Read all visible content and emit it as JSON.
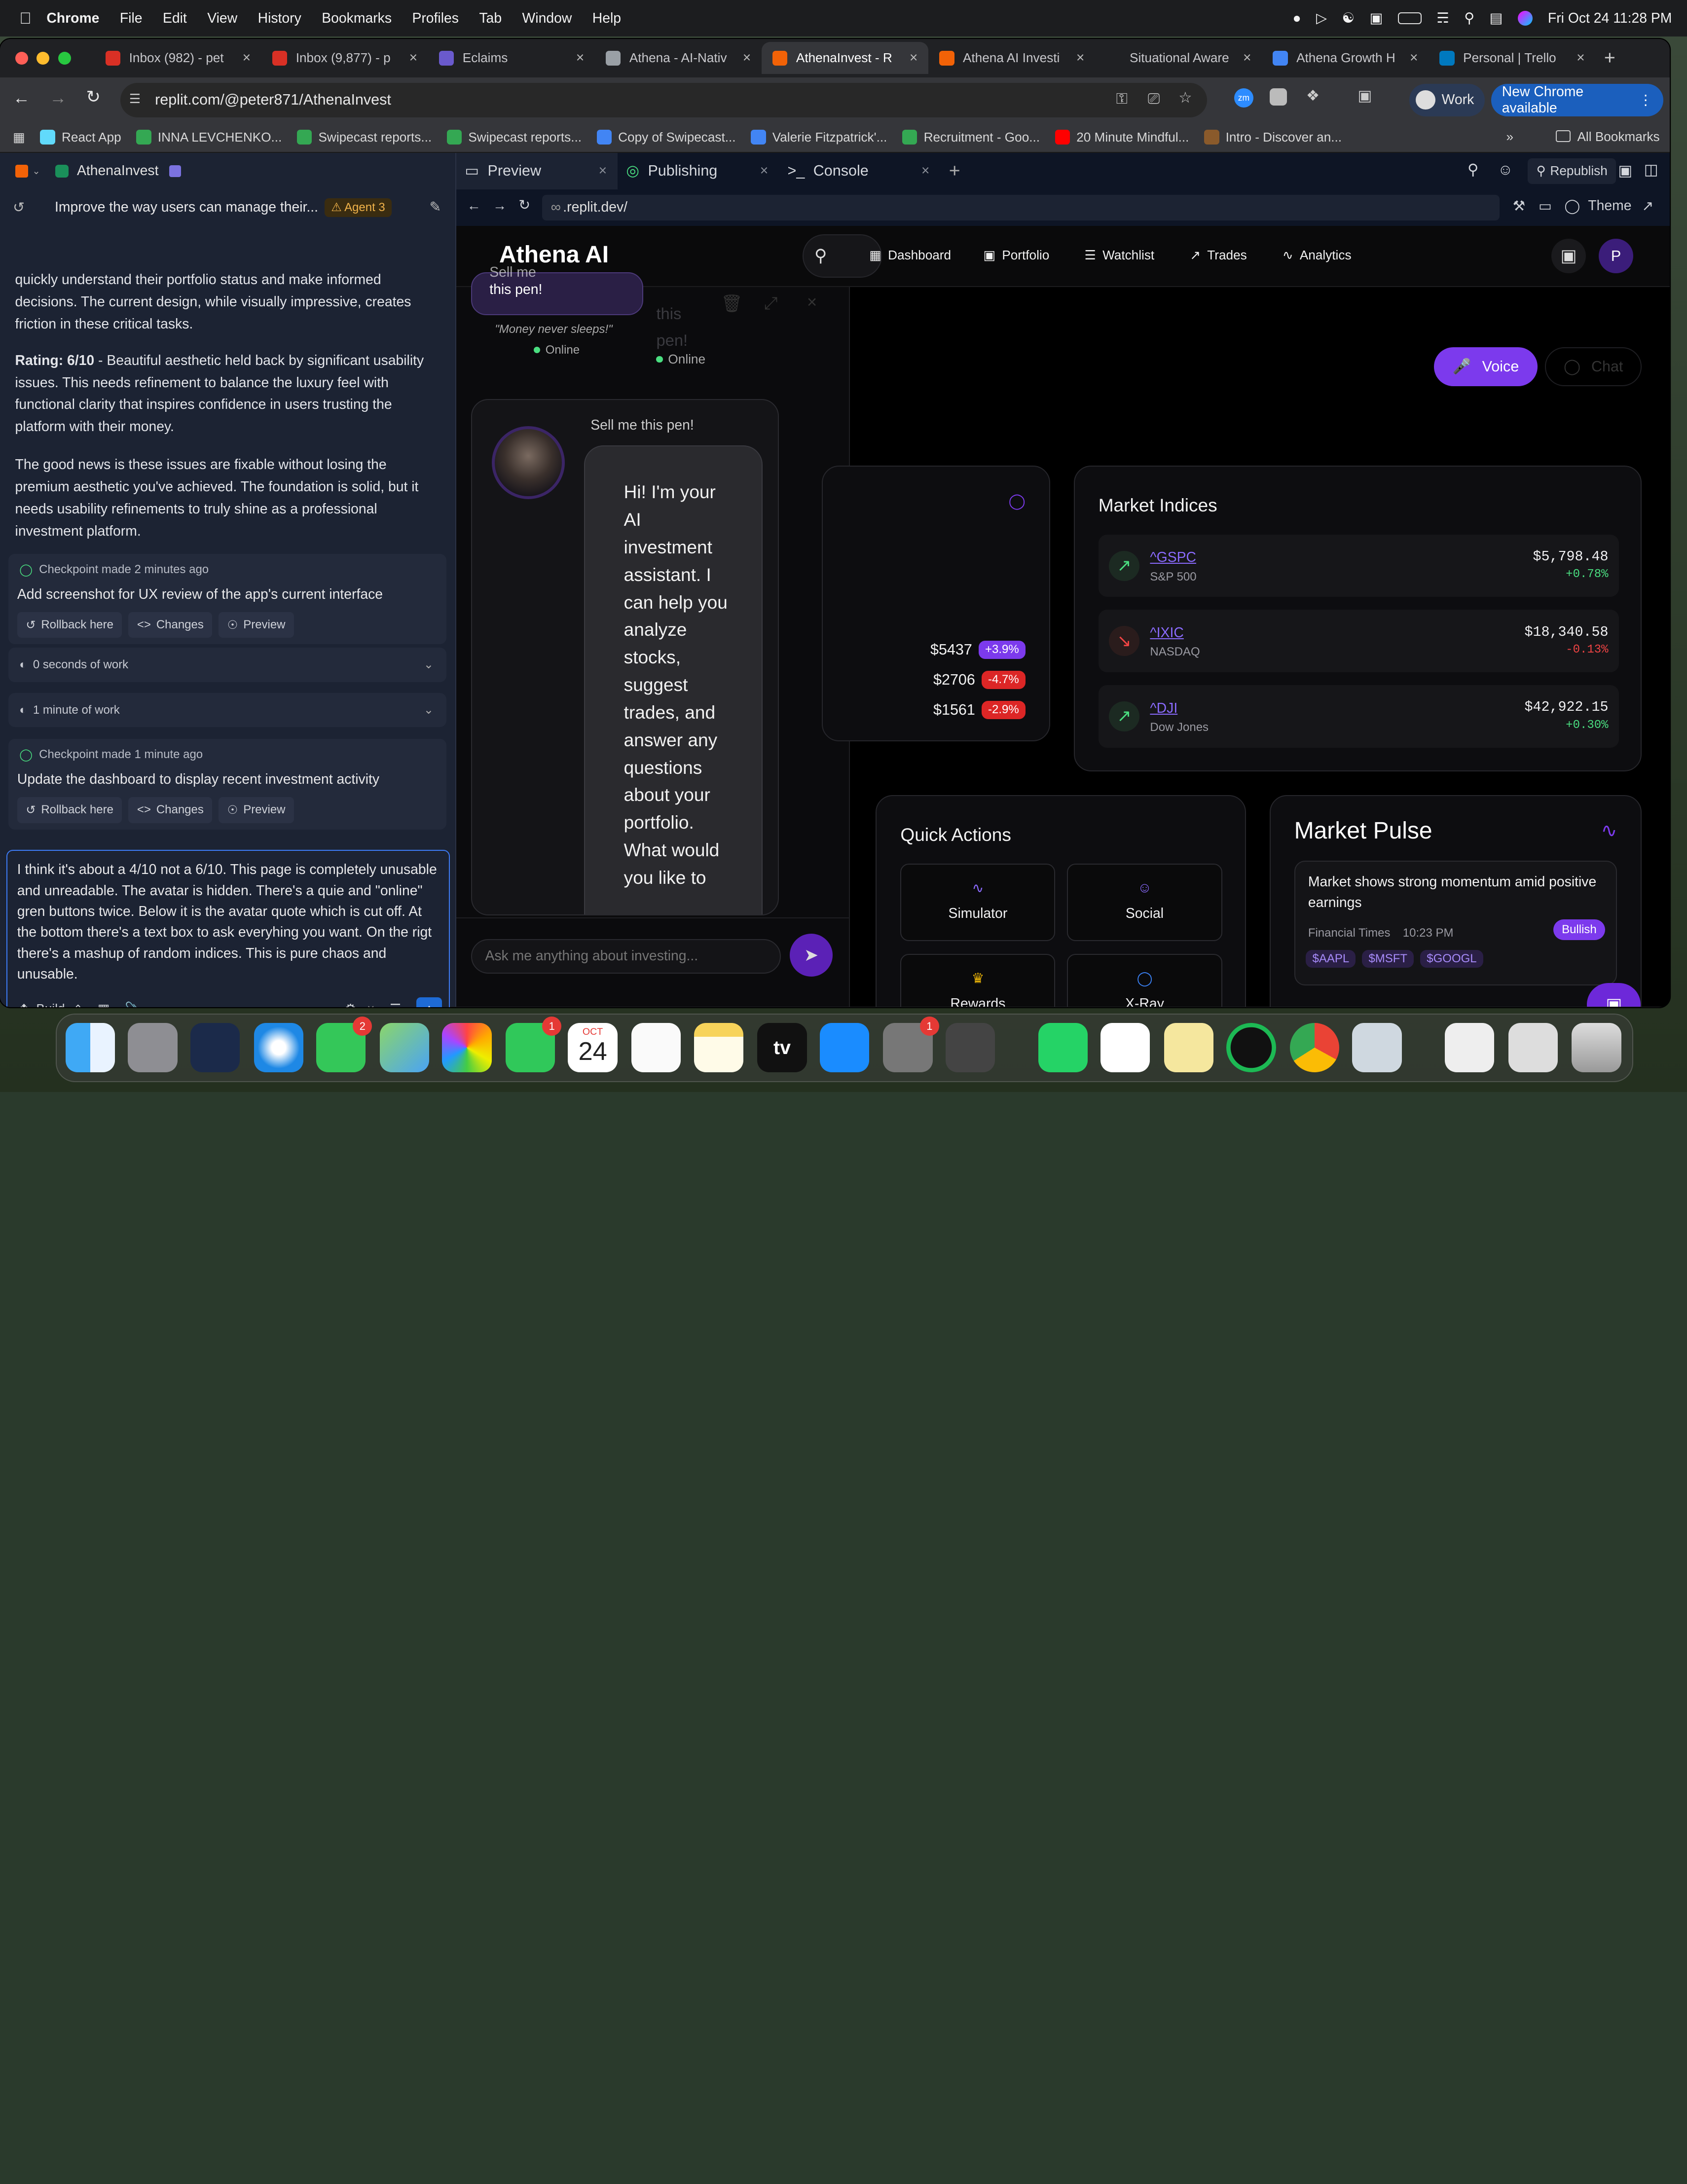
{
  "menubar": {
    "app": "Chrome",
    "items": [
      "File",
      "Edit",
      "View",
      "History",
      "Bookmarks",
      "Profiles",
      "Tab",
      "Window",
      "Help"
    ],
    "clock": "Fri Oct 24  11:28 PM"
  },
  "tabs": [
    {
      "title": "Inbox (982) - pet",
      "color": "#d93025"
    },
    {
      "title": "Inbox (9,877) - p",
      "color": "#d93025"
    },
    {
      "title": "Eclaims",
      "color": "#6a5acd"
    },
    {
      "title": "Athena - AI-Nativ",
      "color": "#9aa0a6"
    },
    {
      "title": "AthenaInvest - R",
      "color": "#f26207",
      "active": true
    },
    {
      "title": "Athena AI Investi",
      "color": "#f26207"
    },
    {
      "title": "Situational Aware",
      "color": "#202124"
    },
    {
      "title": "Athena Growth H",
      "color": "#4285f4"
    },
    {
      "title": "Personal | Trello",
      "color": "#0079bf"
    }
  ],
  "address": {
    "url": "replit.com/@peter871/AthenaInvest",
    "profile": "Work",
    "update": "New Chrome available"
  },
  "bookmarks": [
    {
      "label": "React App",
      "color": "#61dafb"
    },
    {
      "label": "INNA LEVCHENKO...",
      "color": "#34a853"
    },
    {
      "label": "Swipecast reports...",
      "color": "#34a853"
    },
    {
      "label": "Swipecast reports...",
      "color": "#34a853"
    },
    {
      "label": "Copy of Swipecast...",
      "color": "#4285f4"
    },
    {
      "label": "Valerie Fitzpatrick'...",
      "color": "#4285f4"
    },
    {
      "label": "Recruitment - Goo...",
      "color": "#34a853"
    },
    {
      "label": "20 Minute Mindful...",
      "color": "#ff0000"
    },
    {
      "label": "Intro - Discover an...",
      "color": "#8a5a2b"
    }
  ],
  "bookmarks_all": "All Bookmarks",
  "left": {
    "project": "AthenaInvest",
    "thread_title": "Improve the way users can manage their...",
    "agent_badge": "Agent 3",
    "para1": "quickly understand their portfolio status and make informed decisions. The current design, while visually impressive, creates friction in these critical tasks.",
    "rating_label": "Rating: 6/10",
    "rating_text": " - Beautiful aesthetic held back by significant usability issues. This needs refinement to balance the luxury feel with functional clarity that inspires confidence in users trusting the platform with their money.",
    "para3": "The good news is these issues are fixable without losing the premium aesthetic you've achieved. The foundation is solid, but it needs usability refinements to truly shine as a professional investment platform.",
    "checkpoint1": {
      "header": "Checkpoint made 2 minutes ago",
      "title": "Add screenshot for UX review of the app's current interface"
    },
    "work1": "0 seconds of work",
    "work2": "1 minute of work",
    "checkpoint2": {
      "header": "Checkpoint made 1 minute ago",
      "title": "Update the dashboard to display recent investment activity"
    },
    "btn_rollback": "Rollback here",
    "btn_changes": "Changes",
    "btn_preview": "Preview",
    "compose_text": "I think it's about a 4/10 not a 6/10. This page is completely unusable and unreadable.  The avatar is hidden. There's a quie and \"online\" gren buttons twice. Below it is the avatar quote which is cut off. At the bottom there's a text box to ask everyhing you want. On the rigt there's a mashup of random indices. This is pure chaos and unusable. ",
    "build_label": "Build"
  },
  "right_tabs": [
    "Preview",
    "Publishing",
    "Console"
  ],
  "republish": "Republish",
  "webview_url": ".replit.dev/",
  "theme_label": "Theme",
  "app": {
    "brand": "Athena AI",
    "nav": [
      "Dashboard",
      "Portfolio",
      "Watchlist",
      "Trades",
      "Analytics"
    ],
    "avatar_letter": "P",
    "voice": "Voice",
    "chat": "Chat",
    "bubble_top": "this pen!",
    "bubble_top_cut": "Sell me",
    "quote": "\"Money never sleeps!\"",
    "online": "Online",
    "ghost": "this pen!",
    "sell": "Sell me this pen!",
    "assistant_msg": "Hi! I'm your AI investment assistant. I can help you analyze stocks, suggest trades, and answer any questions about your portfolio. What would you like to",
    "chat_placeholder": "Ask me anything about investing...",
    "movers": [
      {
        "price": "$5437",
        "change": "+3.9%",
        "up": true
      },
      {
        "price": "$2706",
        "change": "-4.7%",
        "up": false
      },
      {
        "price": "$1561",
        "change": "-2.9%",
        "up": false
      }
    ],
    "indices_title": "Market Indices",
    "indices": [
      {
        "sym": "^GSPC",
        "name": "S&P 500",
        "price": "$5,798.48",
        "change": "+0.78%",
        "up": true
      },
      {
        "sym": "^IXIC",
        "name": "NASDAQ",
        "price": "$18,340.58",
        "change": "-0.13%",
        "up": false
      },
      {
        "sym": "^DJI",
        "name": "Dow Jones",
        "price": "$42,922.15",
        "change": "+0.30%",
        "up": true
      }
    ],
    "quick_title": "Quick Actions",
    "quick": [
      "Simulator",
      "Social",
      "Rewards",
      "X-Ray"
    ],
    "pulse_title": "Market Pulse",
    "news_title": "Market shows strong momentum amid positive earnings",
    "news_source": "Financial Times",
    "news_time": "10:23 PM",
    "news_tag": "Bullish",
    "tickers": [
      "$AAPL",
      "$MSFT",
      "$GOOGL"
    ]
  },
  "dock": {
    "cal_month": "OCT",
    "cal_day": "24",
    "messages_badge": "2",
    "facetime_badge": "1",
    "settings_badge": "1",
    "tv_label": "tv"
  },
  "colors": {
    "accent": "#7c3aed",
    "up": "#4ade80",
    "down": "#ef4444"
  }
}
